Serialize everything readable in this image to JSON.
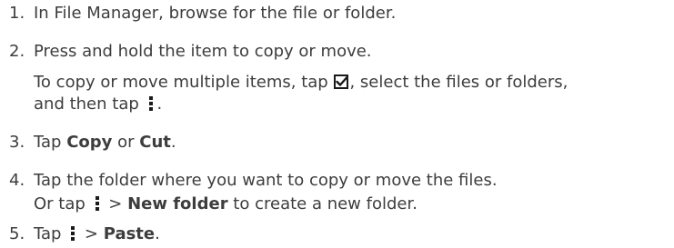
{
  "steps": [
    {
      "num": "1.",
      "text": "In File Manager, browse for the file or folder."
    },
    {
      "num": "2.",
      "text": "Press and hold the item to copy or move.",
      "note_part1": "To copy or move multiple items, tap ",
      "note_part2": ", select the files or folders,",
      "note_line2_part1": "and then tap ",
      "note_line2_part2": "."
    },
    {
      "num": "3.",
      "pre": "Tap ",
      "copy": "Copy",
      "mid": " or ",
      "cut": "Cut",
      "post": "."
    },
    {
      "num": "4.",
      "text": "Tap the folder where you want to copy or move the files.",
      "note_pre": "Or tap ",
      "note_mid": " > ",
      "new_folder": "New folder",
      "note_post": " to create a new folder."
    },
    {
      "num": "5.",
      "pre": "Tap ",
      "mid": " > ",
      "paste": "Paste",
      "post": "."
    }
  ],
  "icons": {
    "multi_select": "checkbox-icon",
    "menu": "more-vertical-icon"
  },
  "colors": {
    "text": "#3d3d3d",
    "icon": "#1a1a1a"
  }
}
